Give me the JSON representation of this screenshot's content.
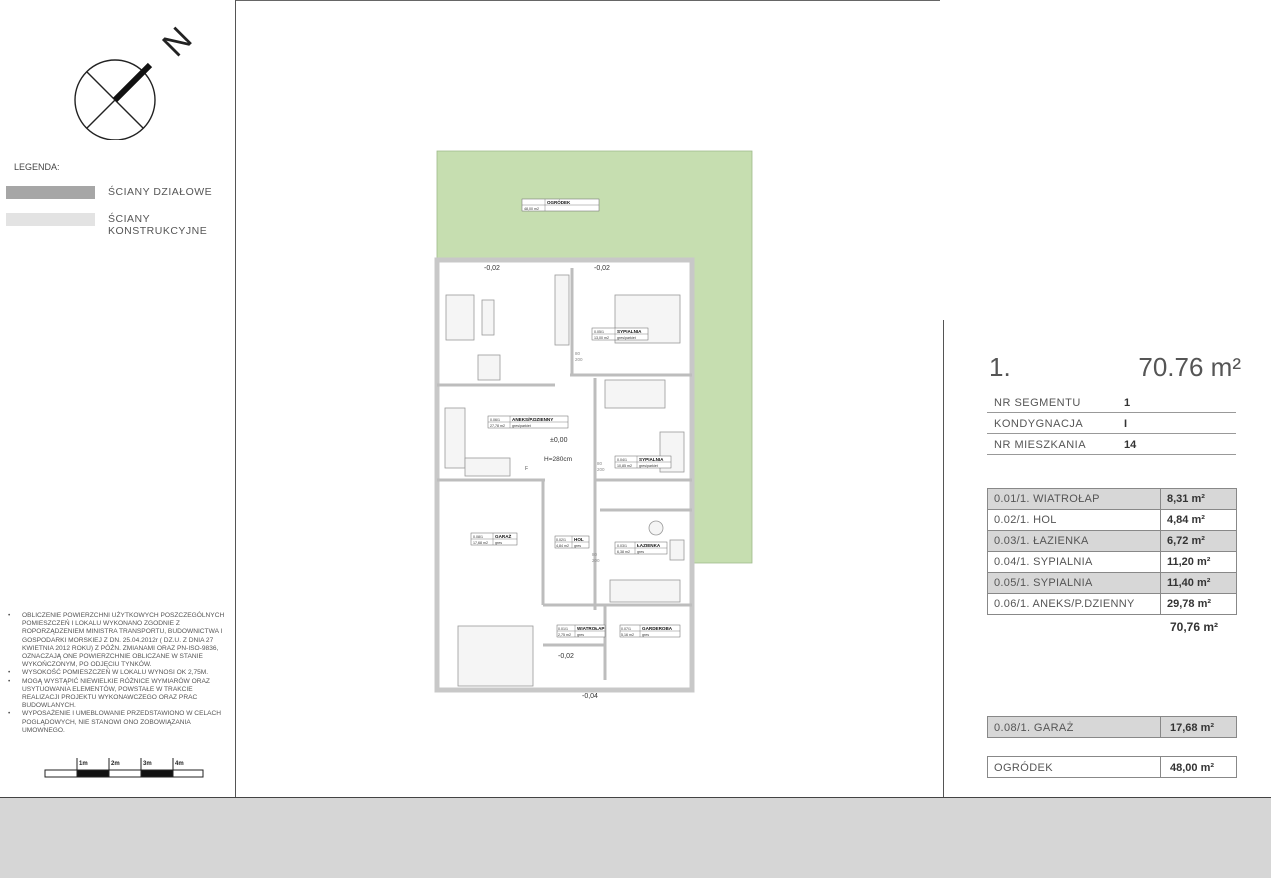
{
  "legend": {
    "title": "LEGENDA:",
    "items": [
      {
        "label": "ŚCIANY DZIAŁOWE",
        "color": "#a6a6a6"
      },
      {
        "label": "ŚCIANY KONSTRUKCYJNE",
        "color": "#e3e3e3"
      }
    ]
  },
  "compass": {
    "letter": "N"
  },
  "notes": [
    "OBLICZENIE POWIERZCHNI UŻYTKOWYCH POSZCZEGÓLNYCH POMIESZCZEŃ I LOKALU WYKONANO ZGODNIE Z ROPORZĄDZENIEM MINISTRA TRANSPORTU, BUDOWNICTWA I GOSPODARKI MORSKIEJ Z DN. 25.04.2012r ( DZ.U. Z DNIA 27 KWIETNIA 2012 ROKU) Z PÓŹN. ZMIANAMI ORAZ PN-ISO-9836, OZNACZAJĄ ONE POWIERZCHNIE OBLICZANE W STANIE WYKOŃCZONYM, PO ODJĘCIU TYNKÓW.",
    "WYSOKOŚĆ POMIESZCZEŃ W LOKALU WYNOSI OK 2,75M.",
    "MOGĄ WYSTĄPIĆ NIEWIELKIE RÓŻNICE WYMIARÓW ORAZ USYTUOWANIA ELEMENTÓW, POWSTAŁE W TRAKCIE REALIZACJI PROJEKTU WYKONAWCZEGO ORAZ PRAC BUDOWLANYCH.",
    "WYPOSAŻENIE I UMEBLOWANIE PRZEDSTAWIONO W CELACH POGLĄDOWYCH, NIE STANOWI ONO ZOBOWIĄZANIA UMOWNEGO."
  ],
  "scale": {
    "labels": [
      "1m",
      "2m",
      "3m",
      "4m"
    ]
  },
  "plan": {
    "garden": {
      "code": "48,00 m2",
      "name": "OGRÓDEK"
    },
    "levels": {
      "top_left": "-0,02",
      "top_right": "-0,02",
      "center": "±0,00",
      "entry": "-0,02",
      "bottom": "-0,04"
    },
    "height": "H=280cm",
    "rooms": [
      {
        "code": "0.05/1",
        "area": "13,00 m2",
        "name": "SYPIALNIA",
        "floor": "gres/parkiet"
      },
      {
        "code": "0.06/1",
        "area": "27,78 m2",
        "name": "ANEKS/P.DZIENNY",
        "floor": "gres/parkiet"
      },
      {
        "code": "0.04/1",
        "area": "10,85 m2",
        "name": "SYPIALNIA",
        "floor": "gres/parkiet"
      },
      {
        "code": "0.08/1",
        "area": "17,68 m2",
        "name": "GARAŻ",
        "floor": "gres"
      },
      {
        "code": "0.02/1",
        "area": "4,84 m2",
        "name": "HOL",
        "floor": "gres"
      },
      {
        "code": "0.03/1",
        "area": "6,38 m2",
        "name": "ŁAZIENKA",
        "floor": "gres"
      },
      {
        "code": "0.01/1",
        "area": "2,75 m2",
        "name": "WIATROŁAP",
        "floor": "gres"
      },
      {
        "code": "0.07/1",
        "area": "5,16 m2",
        "name": "GARDEROBA",
        "floor": "gres"
      }
    ],
    "fridge": "F",
    "door_sizes": [
      "80",
      "200"
    ]
  },
  "summary": {
    "number": "1.",
    "area": "70.76 m²",
    "segment": {
      "label": "NR SEGMENTU",
      "value": "1"
    },
    "floor": {
      "label": "KONDYGNACJA",
      "value": "I"
    },
    "apartment": {
      "label": "NR MIESZKANIA",
      "value": "14"
    }
  },
  "room_table": [
    {
      "name": "0.01/1. WIATROŁAP",
      "area": "8,31 m²",
      "shaded": true
    },
    {
      "name": "0.02/1. HOL",
      "area": "4,84 m²",
      "shaded": false
    },
    {
      "name": "0.03/1. ŁAZIENKA",
      "area": "6,72 m²",
      "shaded": true
    },
    {
      "name": "0.04/1. SYPIALNIA",
      "area": "11,20 m²",
      "shaded": false
    },
    {
      "name": "0.05/1. SYPIALNIA",
      "area": "11,40 m²",
      "shaded": true
    },
    {
      "name": "0.06/1. ANEKS/P.DZIENNY",
      "area": "29,78 m²",
      "shaded": false
    }
  ],
  "room_total": "70,76 m²",
  "garage": {
    "name": "0.08/1. GARAŻ",
    "area": "17,68 m²"
  },
  "garden_row": {
    "name": "OGRÓDEK",
    "area": "48,00 m²"
  },
  "colors": {
    "garden": "#c6deb0",
    "wall": "#bdbdbd",
    "panel_shade": "#d7d7d7"
  }
}
